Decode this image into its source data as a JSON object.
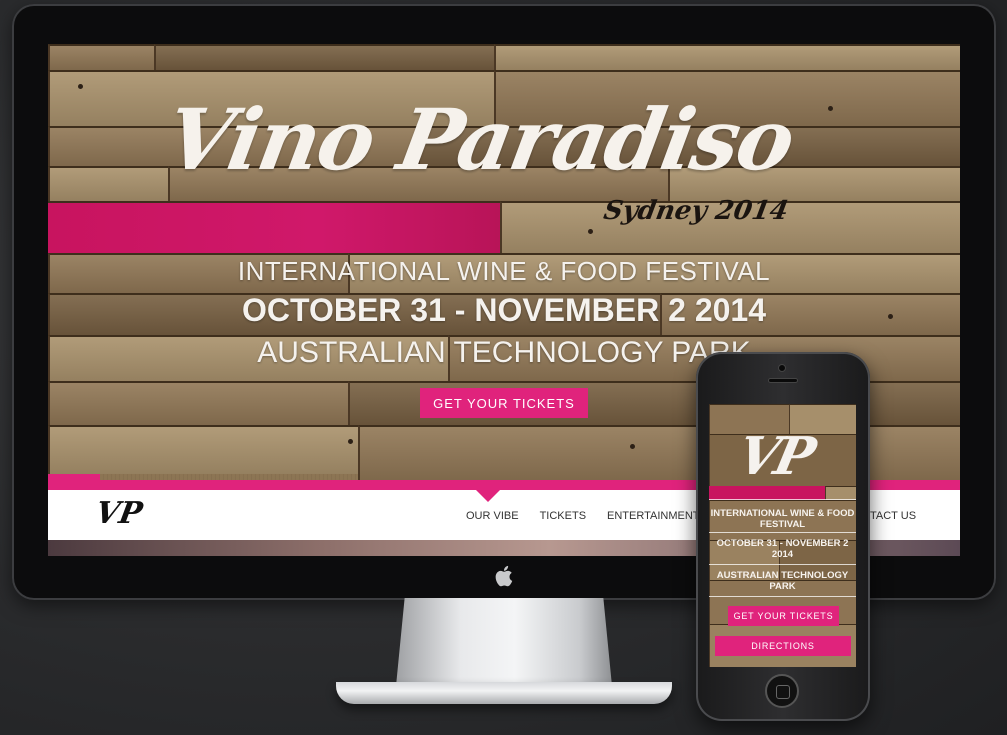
{
  "desktop": {
    "hero": {
      "title": "Vino Paradiso",
      "subtitle": "Sydney 2014",
      "line1": "INTERNATIONAL WINE & FOOD FESTIVAL",
      "line2": "OCTOBER 31 - NOVEMBER 2 2014",
      "line3": "AUSTRALIAN TECHNOLOGY PARK",
      "cta_label": "GET YOUR TICKETS"
    },
    "nav": {
      "logo": "VP",
      "items": [
        "OUR VIBE",
        "TICKETS",
        "ENTERTAINMENT",
        "E"
      ],
      "right_item": "TACT US",
      "active": "OUR VIBE"
    },
    "colors": {
      "accent": "#e0237c",
      "plank_pink": "#c8145f",
      "wood": "#8a7254"
    }
  },
  "mobile": {
    "logo": "VP",
    "line1": "INTERNATIONAL WINE & FOOD FESTIVAL",
    "line2": "OCTOBER 31 - NOVEMBER 2 2014",
    "line3": "AUSTRALIAN TECHNOLOGY PARK",
    "cta_label": "GET YOUR TICKETS",
    "directions_label": "DIRECTIONS"
  },
  "icons": [
    "apple-logo-icon"
  ]
}
